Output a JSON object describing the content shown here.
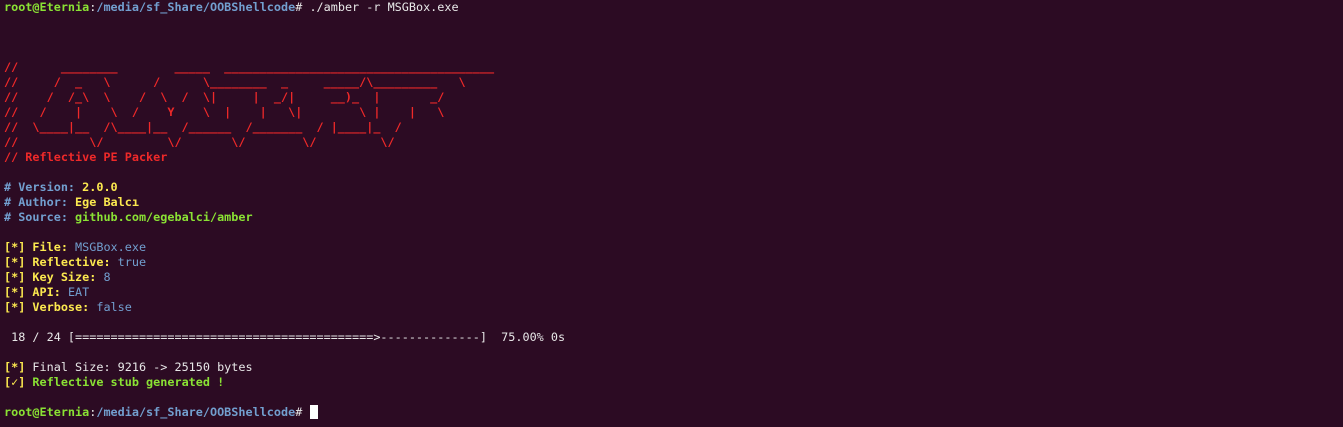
{
  "prompt": {
    "user_host": "root@Eternia",
    "separator": ":",
    "path": "/media/sf_Share/OOBShellcode",
    "symbol": "# "
  },
  "command": "./amber -r MSGBox.exe",
  "banner": [
    "//      ________        _____  ______________________________________",
    "//     /  _   \\      /      \\________  _     _____/\\_________   \\",
    "//    /  /_\\  \\    /  \\  /  \\|     |  _/|     __)_  |       _/",
    "//   /    |    \\  /    Y    \\  |    |   \\|        \\ |    |   \\",
    "//  \\____|__  /\\____|__  /______  /_______  / |____|_  /",
    "//          \\/         \\/       \\/        \\/         \\/",
    "// Reflective PE Packer"
  ],
  "info": [
    {
      "key": "# Version: ",
      "value": "2.0.0"
    },
    {
      "key": "# Author: ",
      "value": "Ege Balcı"
    },
    {
      "key": "# Source: ",
      "value": "github.com/egebalci/amber"
    }
  ],
  "settings": [
    {
      "bracket": "[*]",
      "label": " File: ",
      "value": "MSGBox.exe"
    },
    {
      "bracket": "[*]",
      "label": " Reflective: ",
      "value": "true"
    },
    {
      "bracket": "[*]",
      "label": " Key Size: ",
      "value": "8"
    },
    {
      "bracket": "[*]",
      "label": " API: ",
      "value": "EAT"
    },
    {
      "bracket": "[*]",
      "label": " Verbose: ",
      "value": "false"
    }
  ],
  "progress": {
    "text": " 18 / 24 [==========================================>--------------]  75.00% 0s",
    "current": 18,
    "total": 24,
    "percent": 75.0
  },
  "result": {
    "final_bracket": "[*]",
    "final_text": " Final Size: 9216 -> 25150 bytes",
    "done_bracket": "[✓]",
    "done_text": " Reflective stub generated !"
  },
  "colors": {
    "background": "#2c0b23",
    "green": "#8ae234",
    "blue": "#729fcf",
    "red": "#ef2929",
    "yellow": "#fce94f"
  }
}
